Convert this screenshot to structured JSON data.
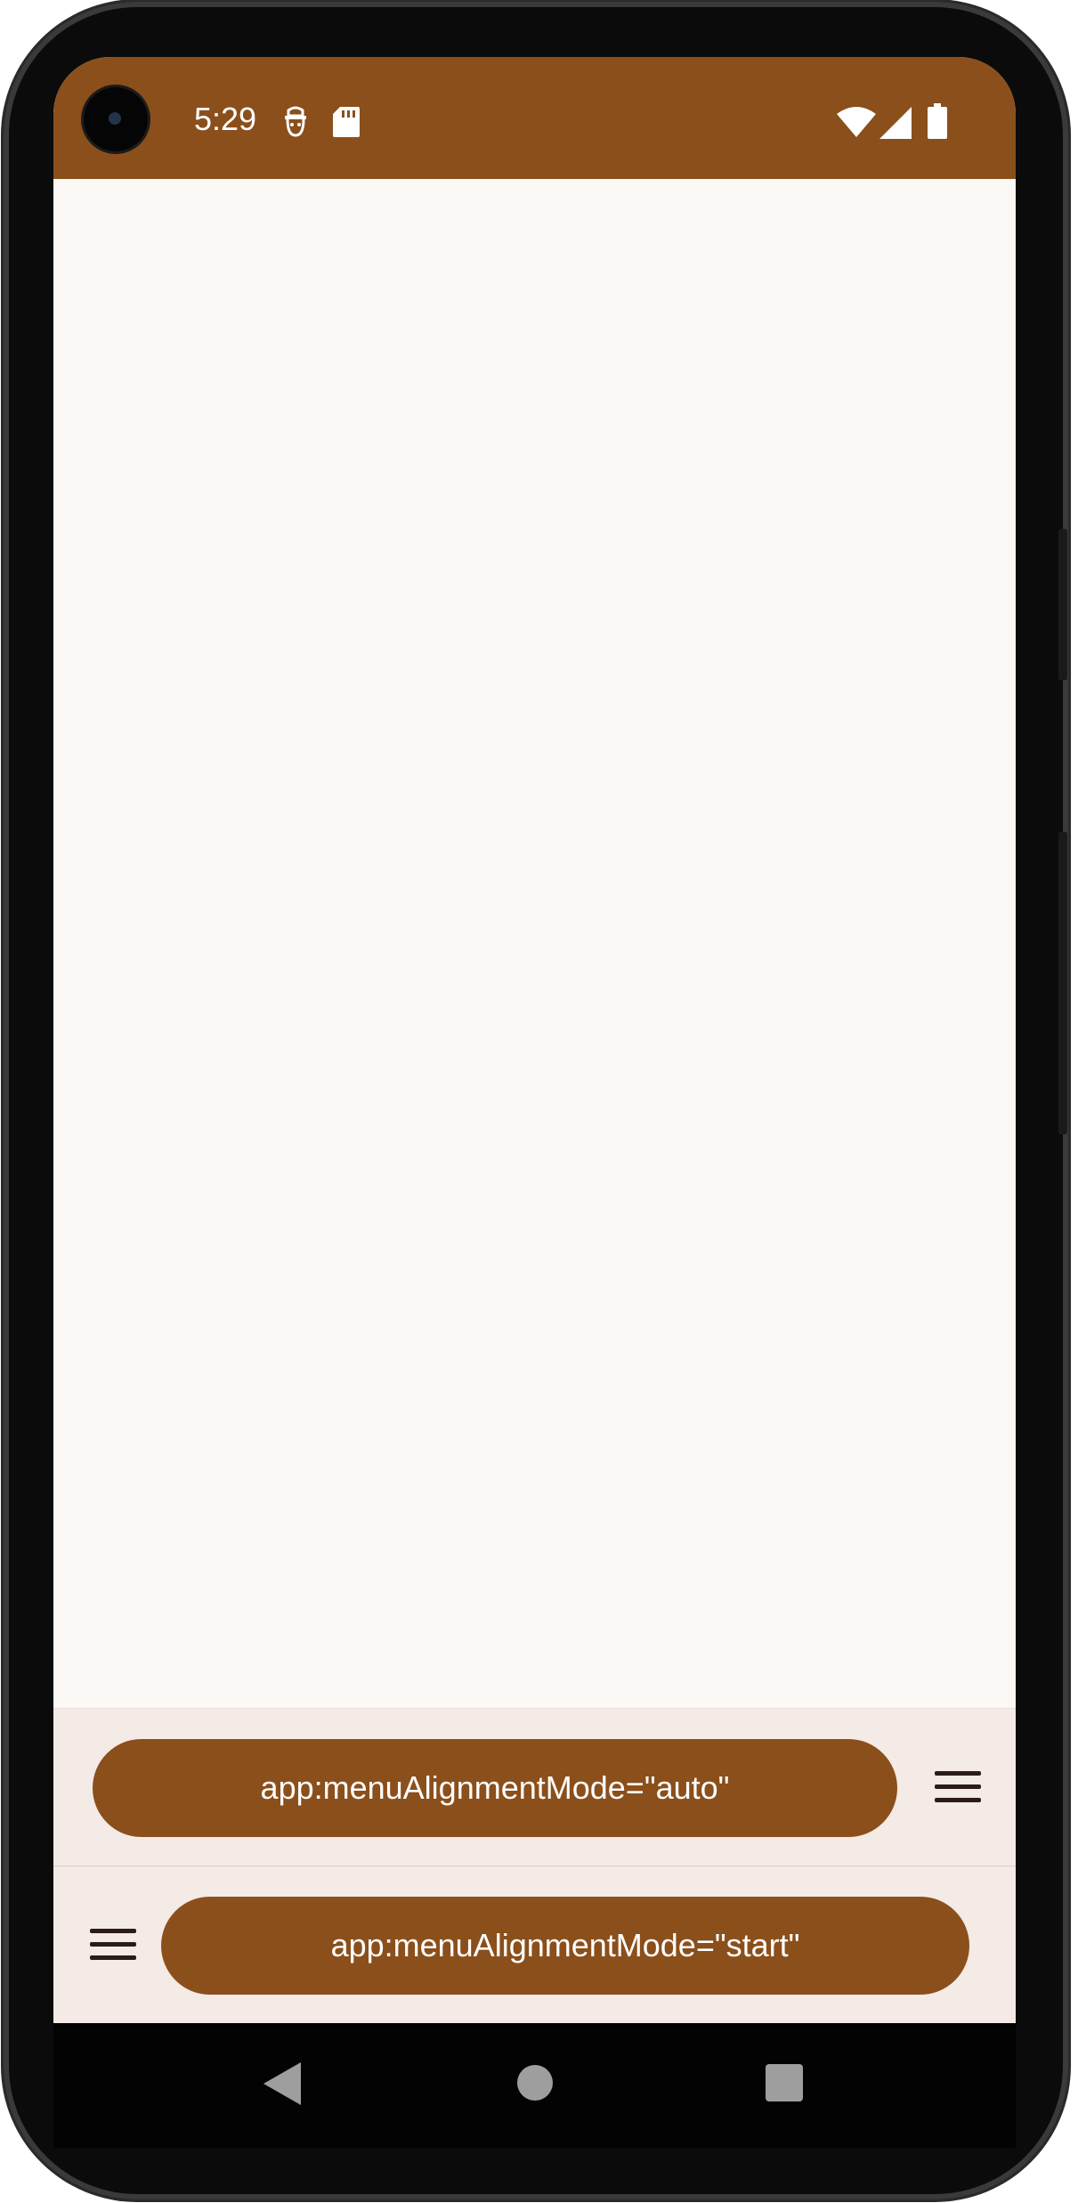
{
  "status_bar": {
    "time": "5:29",
    "icons": [
      "face-notification-icon",
      "sd-card-icon",
      "wifi-icon",
      "cell-signal-icon",
      "battery-icon"
    ],
    "background_color": "#8b4f1b"
  },
  "bottom_bars": [
    {
      "button_label": "app:menuAlignmentMode=\"auto\"",
      "menu_icon": "hamburger-menu-icon",
      "menu_position": "end"
    },
    {
      "button_label": "app:menuAlignmentMode=\"start\"",
      "menu_icon": "hamburger-menu-icon",
      "menu_position": "start"
    }
  ],
  "navigation": {
    "back_icon": "back-triangle-icon",
    "home_icon": "home-circle-icon",
    "recents_icon": "recents-square-icon"
  },
  "colors": {
    "accent": "#8b4f1b",
    "surface": "#fcf8f6",
    "bar_surface": "#f4eae6"
  }
}
